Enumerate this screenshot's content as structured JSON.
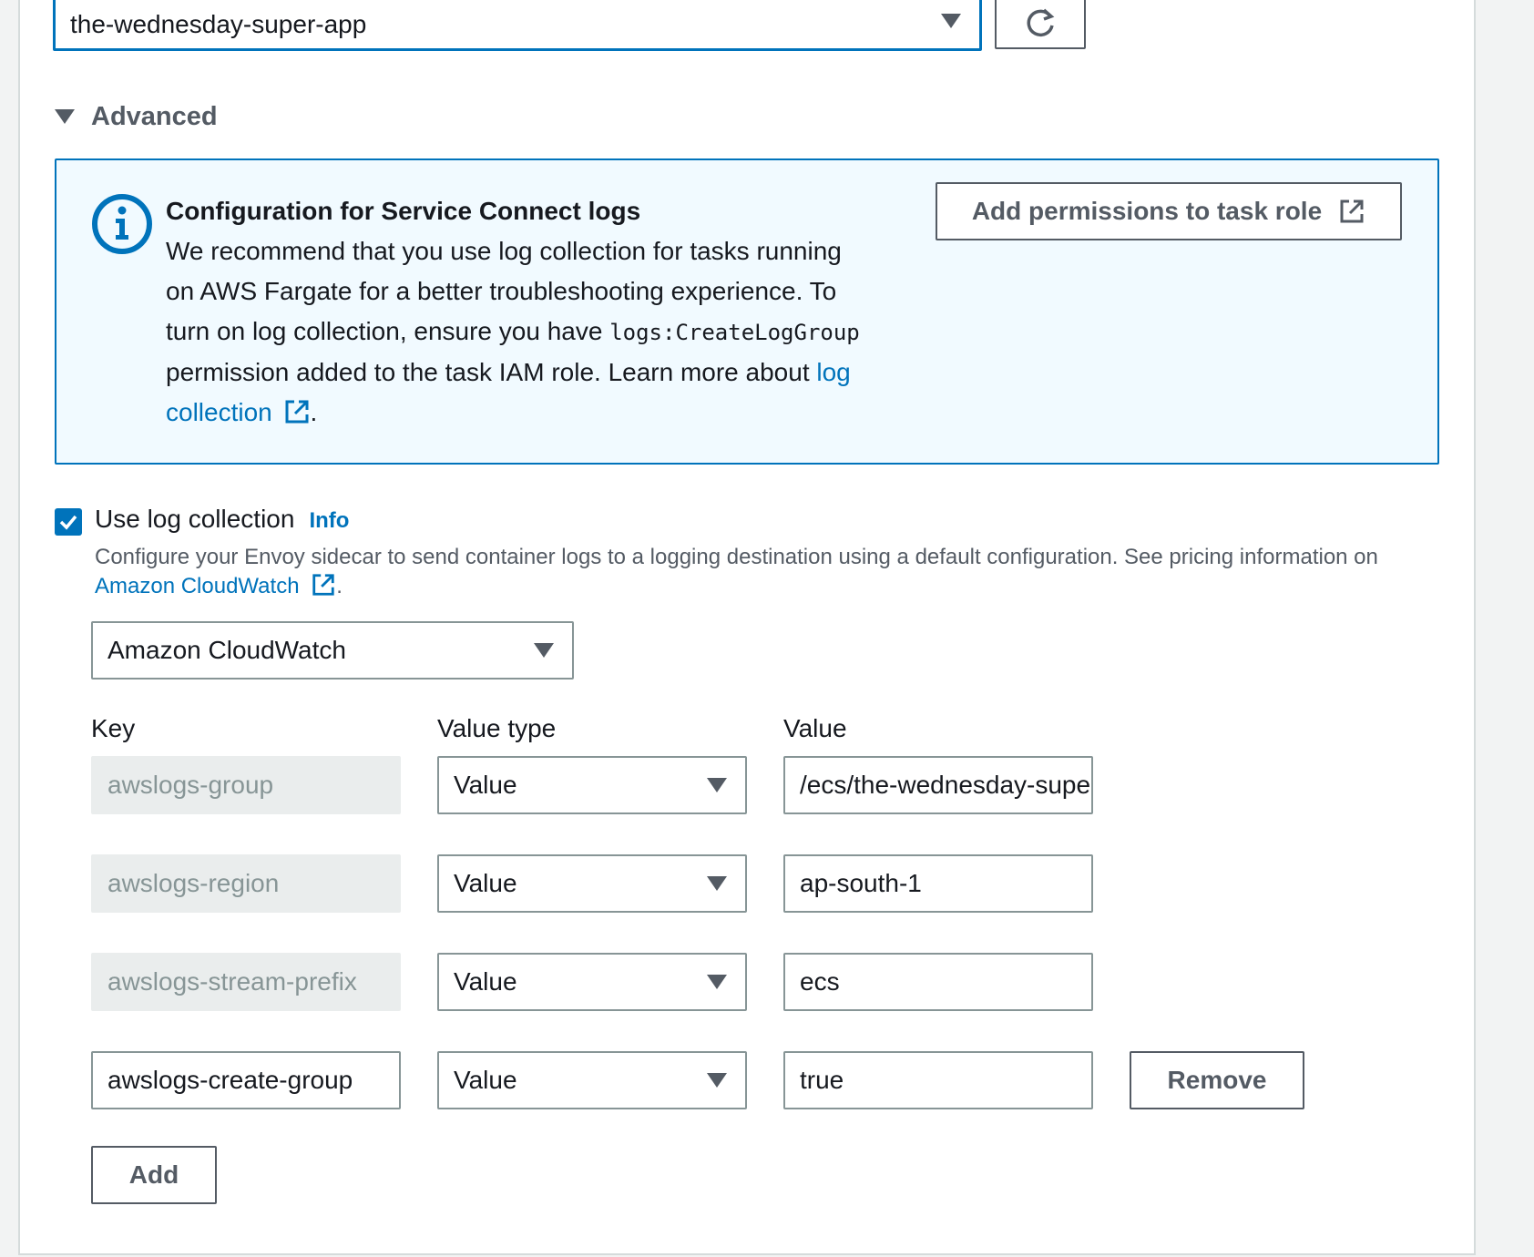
{
  "colors": {
    "accent": "#0073bb",
    "border": "#879596",
    "text": "#16191f",
    "muted": "#545b64",
    "info_bg": "#f1faff"
  },
  "namespace": {
    "selected": "the-wednesday-super-app",
    "refresh_icon": "refresh-icon"
  },
  "advanced": {
    "label": "Advanced"
  },
  "info": {
    "title": "Configuration for Service Connect logs",
    "line1": "We recommend that you use log collection for tasks running",
    "line2": "on AWS Fargate for a better troubleshooting experience. To",
    "line3_pre": "turn on log collection, ensure you have ",
    "line3_code": "logs:CreateLogGroup",
    "line4_pre": "permission added to the task IAM role. Learn more about ",
    "link_a": "log",
    "link_b": "collection",
    "after_link": ".",
    "button": "Add permissions to task role"
  },
  "log_collection": {
    "checked": true,
    "label": "Use log collection",
    "info_link": "Info",
    "description": "Configure your Envoy sidecar to send container logs to a logging destination using a default configuration. See pricing information on",
    "desc_link": "Amazon CloudWatch",
    "desc_after": ".",
    "destination": "Amazon CloudWatch"
  },
  "table": {
    "headers": {
      "key": "Key",
      "value_type": "Value type",
      "value": "Value"
    },
    "rows": [
      {
        "key": "awslogs-group",
        "value_type": "Value",
        "value": "/ecs/the-wednesday-super-app"
      },
      {
        "key": "awslogs-region",
        "value_type": "Value",
        "value": "ap-south-1"
      },
      {
        "key": "awslogs-stream-prefix",
        "value_type": "Value",
        "value": "ecs"
      },
      {
        "key": "awslogs-create-group",
        "value_type": "Value",
        "value": "true"
      }
    ],
    "remove_label": "Remove",
    "add_label": "Add"
  }
}
